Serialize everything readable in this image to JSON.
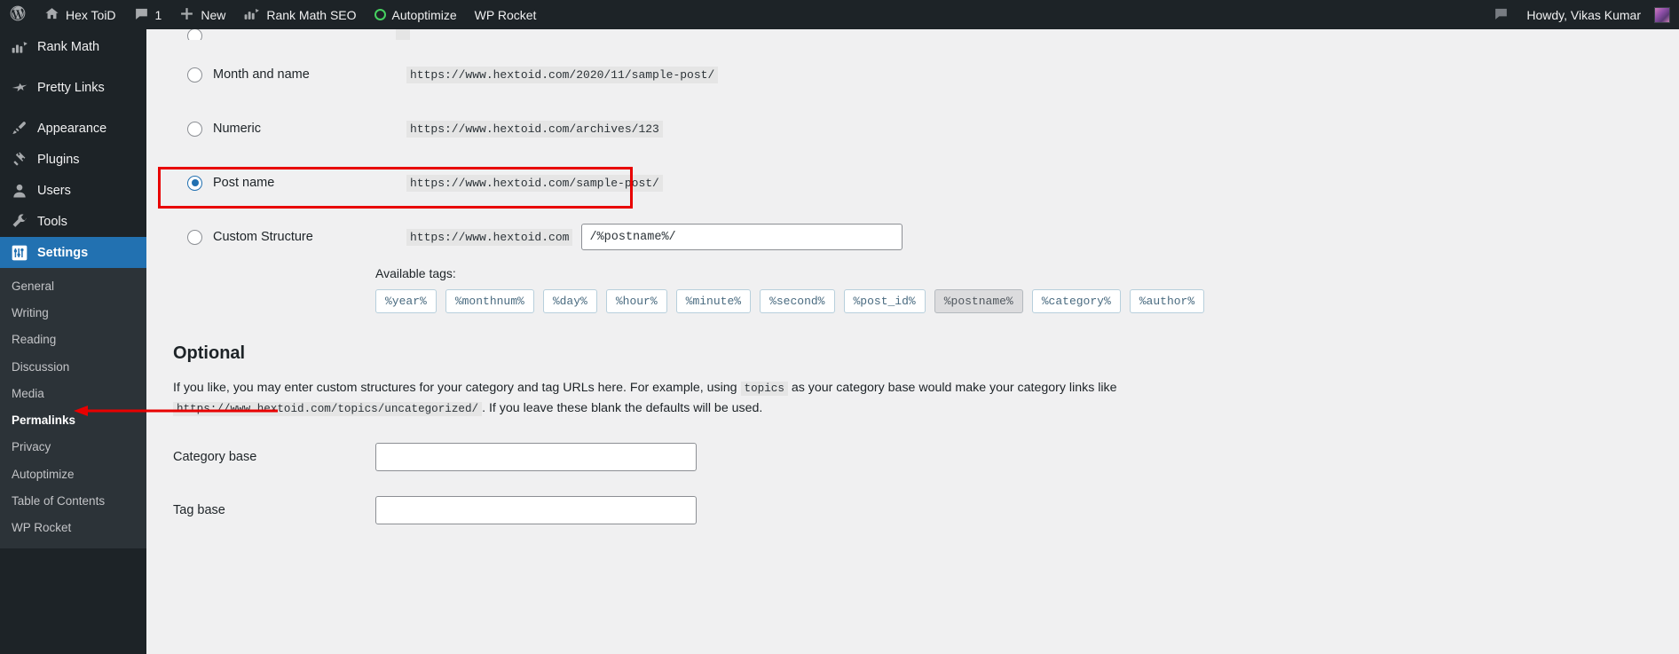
{
  "adminbar": {
    "logo_icon": "wordpress-logo-icon",
    "site_icon": "home-icon",
    "site_name": "Hex ToiD",
    "comments_icon": "comment-bubble-icon",
    "comments_count": "1",
    "new_icon": "plus-icon",
    "new_label": "New",
    "rankmath_icon": "rank-math-icon",
    "rankmath_label": "Rank Math SEO",
    "autoptimize_icon": "autoptimize-circle-icon",
    "autoptimize_label": "Autoptimize",
    "wprocket_label": "WP Rocket",
    "notice_icon": "speech-bubble-icon",
    "howdy": "Howdy, Vikas Kumar",
    "avatar": "user-avatar"
  },
  "sidebar": {
    "top_items": [
      {
        "label": "Rank Math",
        "icon": "rank-math-icon",
        "current": false
      },
      {
        "label": "Pretty Links",
        "icon": "pretty-links-icon",
        "current": false
      },
      {
        "label": "Appearance",
        "icon": "appearance-brush-icon",
        "current": false
      },
      {
        "label": "Plugins",
        "icon": "plugins-plug-icon",
        "current": false
      },
      {
        "label": "Users",
        "icon": "users-icon",
        "current": false
      },
      {
        "label": "Tools",
        "icon": "tools-wrench-icon",
        "current": false
      },
      {
        "label": "Settings",
        "icon": "settings-sliders-icon",
        "current": true
      }
    ],
    "submenu": [
      {
        "label": "General",
        "current": false
      },
      {
        "label": "Writing",
        "current": false
      },
      {
        "label": "Reading",
        "current": false
      },
      {
        "label": "Discussion",
        "current": false
      },
      {
        "label": "Media",
        "current": false
      },
      {
        "label": "Permalinks",
        "current": true
      },
      {
        "label": "Privacy",
        "current": false
      },
      {
        "label": "Autoptimize",
        "current": false
      },
      {
        "label": "Table of Contents",
        "current": false
      },
      {
        "label": "WP Rocket",
        "current": false
      }
    ]
  },
  "permalinks": {
    "options": [
      {
        "label": "Month and name",
        "url": "https://www.hextoid.com/2020/11/sample-post/",
        "checked": false,
        "highlighted": false
      },
      {
        "label": "Numeric",
        "url": "https://www.hextoid.com/archives/123",
        "checked": false,
        "highlighted": false
      },
      {
        "label": "Post name",
        "url": "https://www.hextoid.com/sample-post/",
        "checked": true,
        "highlighted": true
      }
    ],
    "custom": {
      "label": "Custom Structure",
      "prefix": "https://www.hextoid.com",
      "value": "/%postname%/",
      "placeholder": ""
    },
    "available_tags_label": "Available tags:",
    "tags": [
      {
        "label": "%year%",
        "used": false
      },
      {
        "label": "%monthnum%",
        "used": false
      },
      {
        "label": "%day%",
        "used": false
      },
      {
        "label": "%hour%",
        "used": false
      },
      {
        "label": "%minute%",
        "used": false
      },
      {
        "label": "%second%",
        "used": false
      },
      {
        "label": "%post_id%",
        "used": false
      },
      {
        "label": "%postname%",
        "used": true
      },
      {
        "label": "%category%",
        "used": false
      },
      {
        "label": "%author%",
        "used": false
      }
    ]
  },
  "optional": {
    "heading": "Optional",
    "desc_part1": "If you like, you may enter custom structures for your category and tag URLs here. For example, using",
    "desc_code1": "topics",
    "desc_part2": "as your category base would make your category links like",
    "desc_code2": "https://www.hextoid.com/topics/uncategorized/",
    "desc_part3": ". If you leave these blank the defaults will be used.",
    "category_base_label": "Category base",
    "category_base_value": "",
    "tag_base_label": "Tag base",
    "tag_base_value": ""
  },
  "annotations": {
    "highlight_color": "#e80000",
    "arrow_color": "#e80000",
    "highlight_target": "Post name",
    "arrow_target": "Permalinks"
  }
}
